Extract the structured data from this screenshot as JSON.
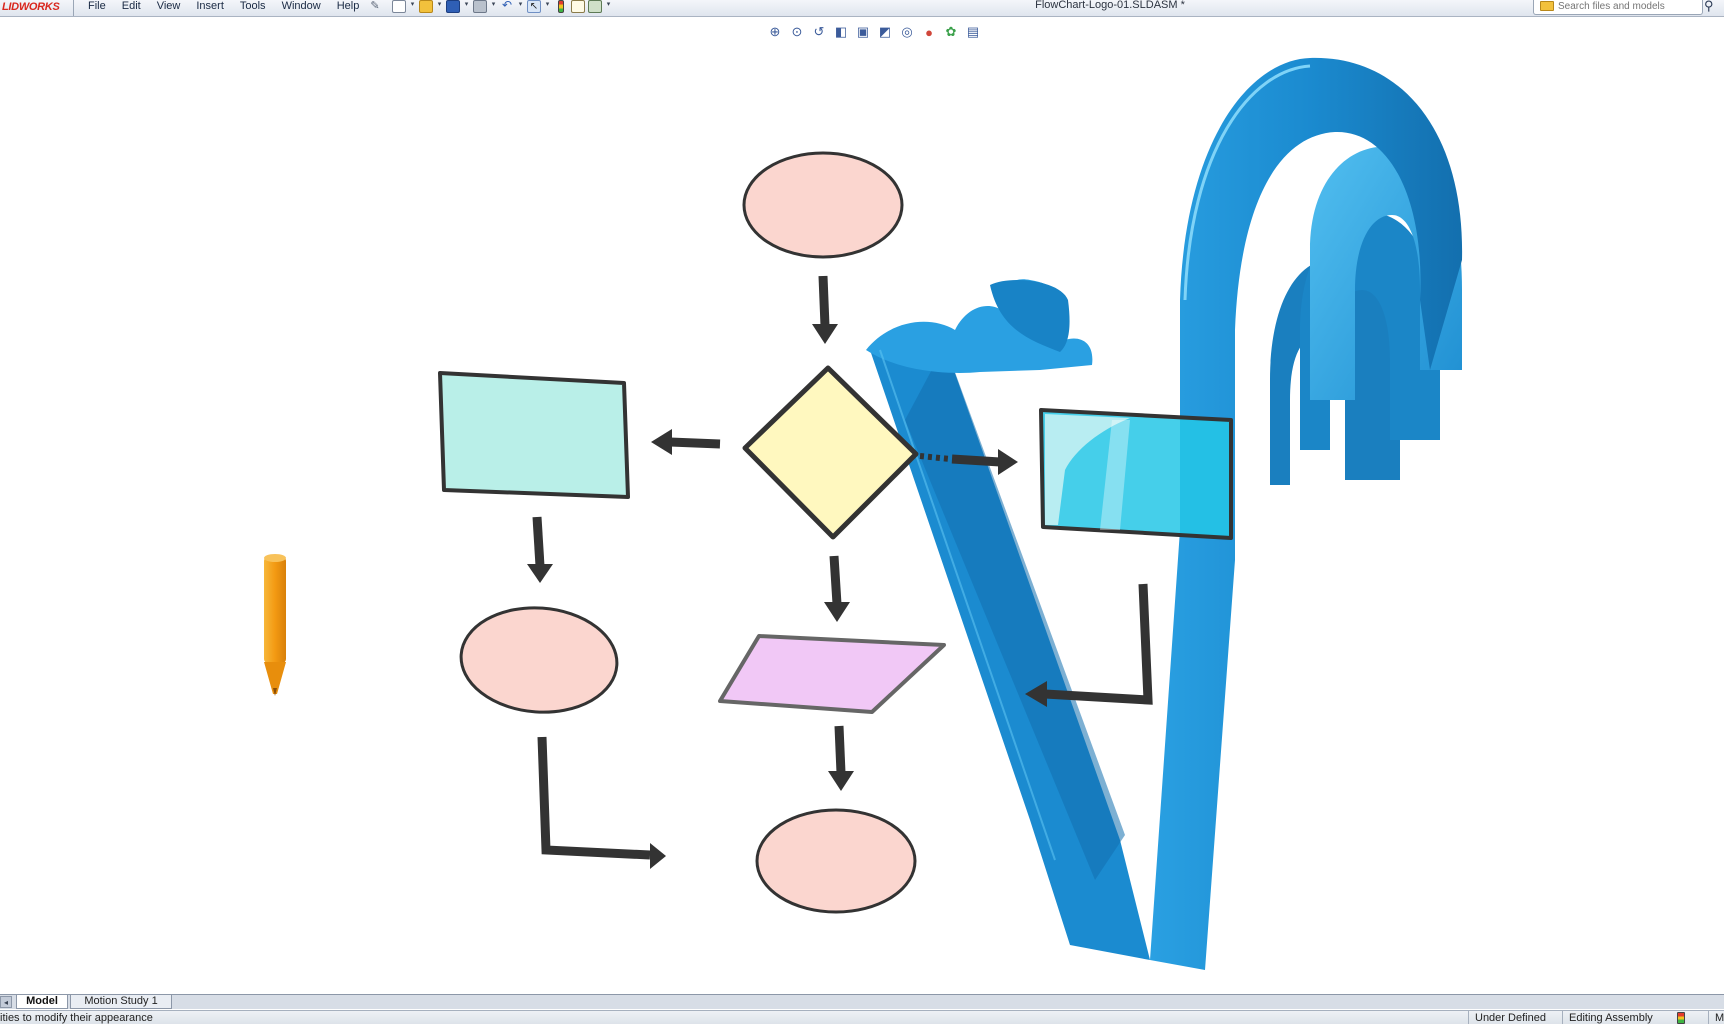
{
  "app": {
    "brand": "LIDWORKS",
    "document_title": "FlowChart-Logo-01.SLDASM *"
  },
  "menu": {
    "items": [
      "File",
      "Edit",
      "View",
      "Insert",
      "Tools",
      "Window",
      "Help"
    ]
  },
  "toolbar": {
    "icons": [
      "new-document-icon",
      "open-folder-icon",
      "save-icon",
      "print-icon",
      "undo-icon",
      "select-arrow-icon",
      "traffic-light-icon",
      "properties-icon",
      "options-icon"
    ]
  },
  "search": {
    "placeholder": "Search files and models"
  },
  "heads_up_toolbar": {
    "icons": [
      "zoom-to-fit-icon",
      "zoom-to-area-icon",
      "previous-view-icon",
      "section-view-icon",
      "view-orientation-icon",
      "display-style-icon",
      "hide-show-items-icon",
      "edit-appearance-icon",
      "apply-scene-icon",
      "view-settings-icon"
    ]
  },
  "bottom_tabs": {
    "model": "Model",
    "motion_study": "Motion Study 1"
  },
  "status": {
    "message": "ities to modify their appearance",
    "definition": "Under Defined",
    "mode": "Editing Assembly",
    "units": "M"
  },
  "colors": {
    "terminator_fill": "#fbd6cf",
    "process_fill": "#b9efe8",
    "decision_fill": "#fff8bf",
    "io_fill": "#f1c8f6",
    "logo_blue": "#1b8bd0",
    "pencil_orange": "#f3a21c",
    "arrow": "#333333"
  }
}
